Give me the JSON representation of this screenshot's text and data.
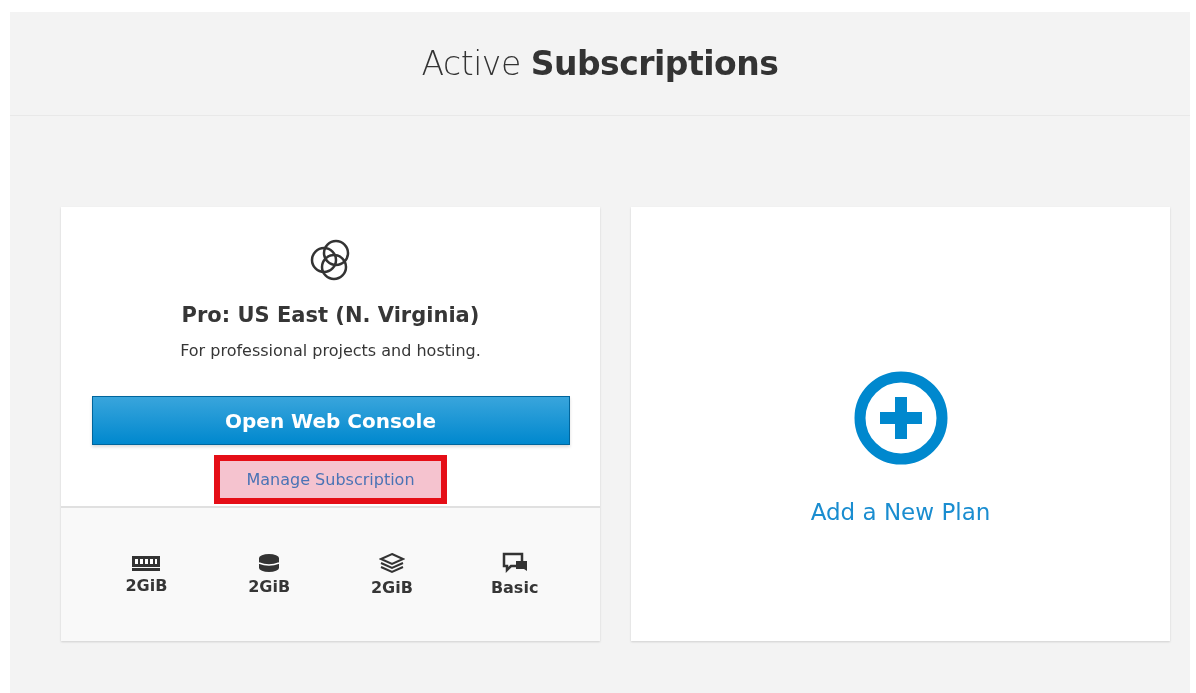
{
  "header": {
    "title": "Active **Subscriptions**"
  },
  "subscription": {
    "name": "Pro: US East (N. Virginia)",
    "description": "For professional projects and hosting.",
    "primary_button": "Open Web Console",
    "manage_link": {
      "label": "Manage Subscription",
      "highlighted": true
    },
    "specs": [
      {
        "kind": "memory",
        "value": "2GiB"
      },
      {
        "kind": "storage",
        "value": "2GiB"
      },
      {
        "kind": "layers",
        "value": "2GiB"
      },
      {
        "kind": "support",
        "value": "Basic"
      }
    ]
  },
  "add_plan": {
    "label": "Add a New Plan"
  }
}
